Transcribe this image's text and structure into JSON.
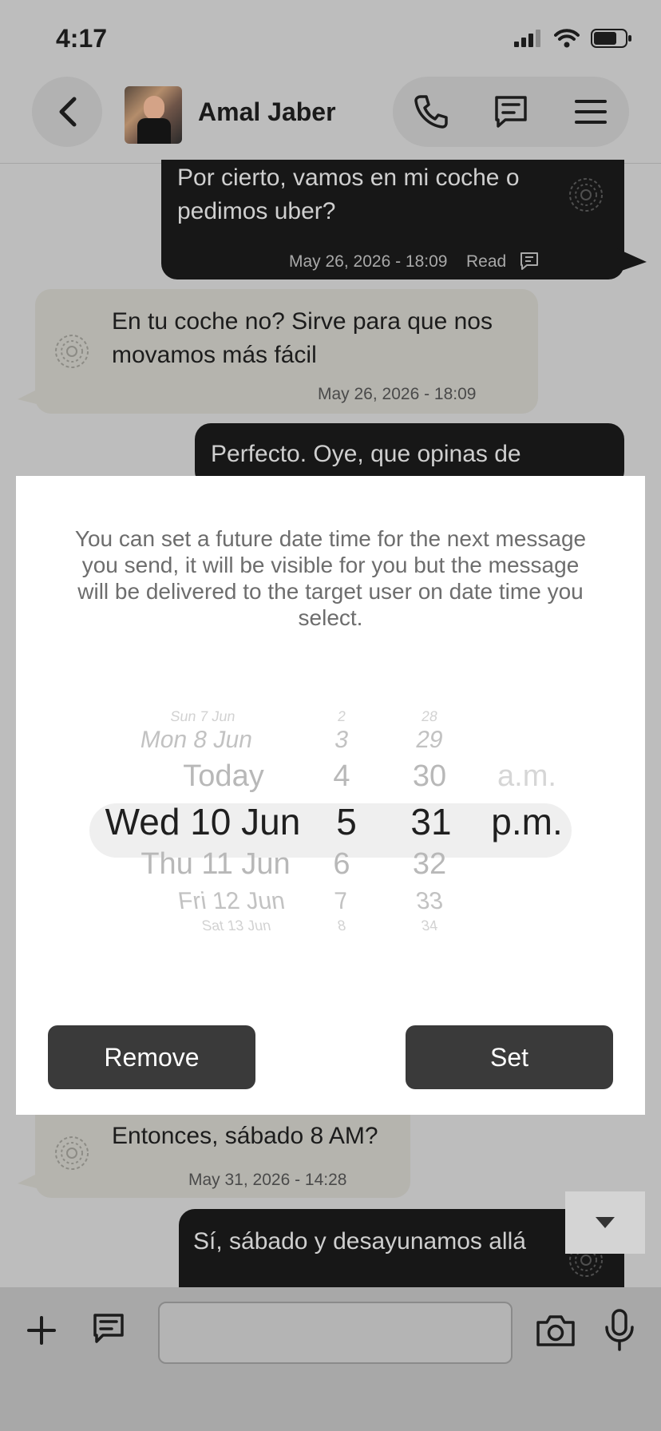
{
  "status_bar": {
    "time": "4:17"
  },
  "header": {
    "contact_name": "Amal Jaber"
  },
  "messages": [
    {
      "text_lines": [
        "Por cierto, vamos en mi coche o",
        "pedimos uber?"
      ],
      "timestamp": "May 26, 2026 - 18:09",
      "status": "Read"
    },
    {
      "text_lines": [
        "En tu coche no? Sirve para que nos",
        "movamos más fácil"
      ],
      "timestamp": "May 26, 2026 - 18:09"
    },
    {
      "text_lines": [
        "Perfecto. Oye, que opinas de"
      ]
    },
    {
      "text_lines": [
        "Entonces, sábado 8 AM?"
      ],
      "timestamp": "May 31, 2026 - 14:28"
    },
    {
      "text_lines": [
        "Sí, sábado y desayunamos allá"
      ]
    }
  ],
  "modal": {
    "description_lines": [
      "You can set a future date time for the next message",
      "you send, it will be visible for you but the message",
      "will be delivered to the target user on date time you",
      "select."
    ],
    "picker": {
      "dates": [
        "Sun 7 Jun",
        "Mon 8 Jun",
        "Today",
        "Wed 10 Jun",
        "Thu 11 Jun",
        "Fri 12 Jun",
        "Sat 13 Jun"
      ],
      "hours": [
        "2",
        "3",
        "4",
        "5",
        "6",
        "7",
        "8"
      ],
      "minutes": [
        "28",
        "29",
        "30",
        "31",
        "32",
        "33",
        "34"
      ],
      "periods": [
        "a.m.",
        "p.m."
      ],
      "selected": {
        "date": "Wed 10 Jun",
        "hour": "5",
        "minute": "31",
        "period": "p.m."
      }
    },
    "remove_label": "Remove",
    "set_label": "Set"
  },
  "icons": {
    "back": "chevron-left-icon",
    "call": "phone-icon",
    "chat": "message-icon",
    "menu": "hamburger-menu-icon",
    "attach": "plus-icon",
    "camera": "camera-icon",
    "mic": "microphone-icon",
    "scroll_down": "caret-down-icon"
  },
  "colors": {
    "outgoing_bubble": "#171717",
    "incoming_bubble": "#b5b4ae",
    "button": "#3a3a3a",
    "overlay": "#bdbdbd"
  }
}
